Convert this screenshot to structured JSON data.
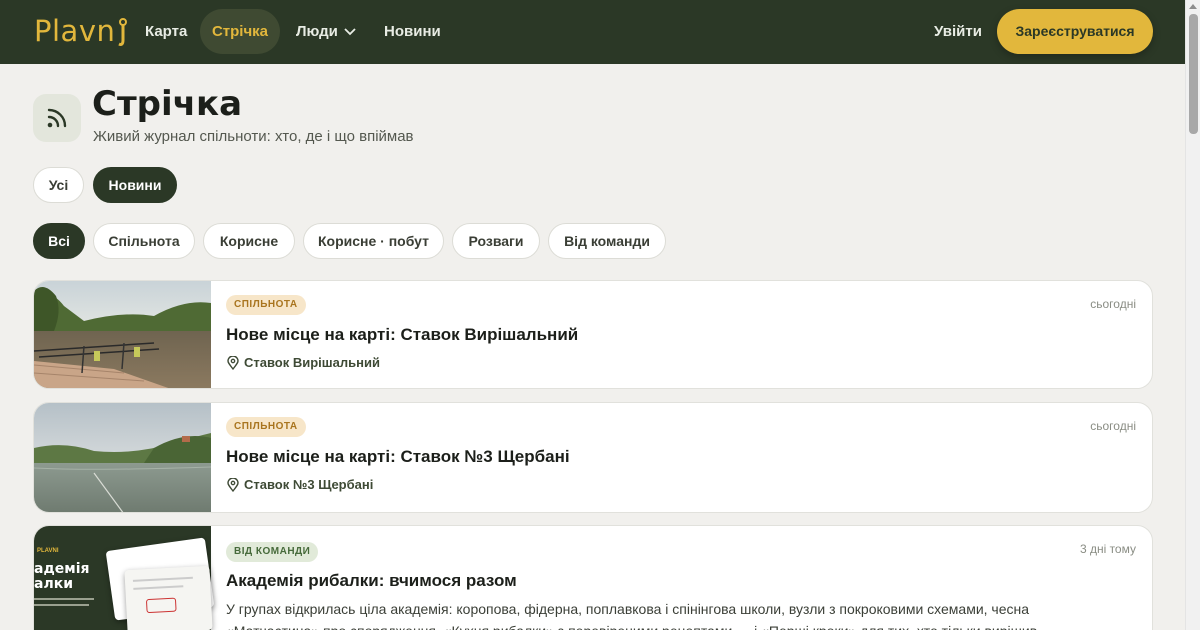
{
  "header": {
    "logo": "Plavni",
    "nav": [
      {
        "label": "Карта"
      },
      {
        "label": "Стрічка"
      },
      {
        "label": "Люди"
      },
      {
        "label": "Новини"
      }
    ],
    "login": "Увійти",
    "register": "Зареєструватися"
  },
  "page": {
    "title": "Стрічка",
    "subtitle": "Живий журнал спільноти: хто, де і що впіймав"
  },
  "main_filters": [
    {
      "label": "Усі",
      "active": false
    },
    {
      "label": "Новини",
      "active": true
    }
  ],
  "category_filters": [
    {
      "label": "Всі",
      "active": true
    },
    {
      "label": "Спільнота",
      "active": false
    },
    {
      "label": "Корисне",
      "active": false
    },
    {
      "label": "Корисне · побут",
      "active": false
    },
    {
      "label": "Розваги",
      "active": false
    },
    {
      "label": "Від команди",
      "active": false
    }
  ],
  "feed": [
    {
      "tag": "СПІЛЬНОТА",
      "date": "сьогодні",
      "title": "Нове місце на карті: Ставок Вирішальний",
      "location": "Ставок Вирішальний"
    },
    {
      "tag": "СПІЛЬНОТА",
      "date": "сьогодні",
      "title": "Нове місце на карті: Ставок №3 Щербані",
      "location": "Ставок №3 Щербані"
    },
    {
      "tag": "ВІД КОМАНДИ",
      "date": "3 дні тому",
      "title": "Академія рибалки: вчимося разом",
      "text": "У групах відкрилась ціла академія: коропова, фідерна, поплавкова і спінінгова школи, вузли з покроковими схемами, чесна «Матчастина» про спорядження, «Кухня рибалки» з перевіреними рецептами — і «Перші кроки» для тих, хто тільки вирішив",
      "image_text": {
        "brand": "PLAVNI",
        "line1": "адемія",
        "line2": "алки"
      }
    }
  ],
  "colors": {
    "header_bg": "#2b3826",
    "accent": "#e2b73c",
    "page_bg": "#f1f0ed"
  }
}
